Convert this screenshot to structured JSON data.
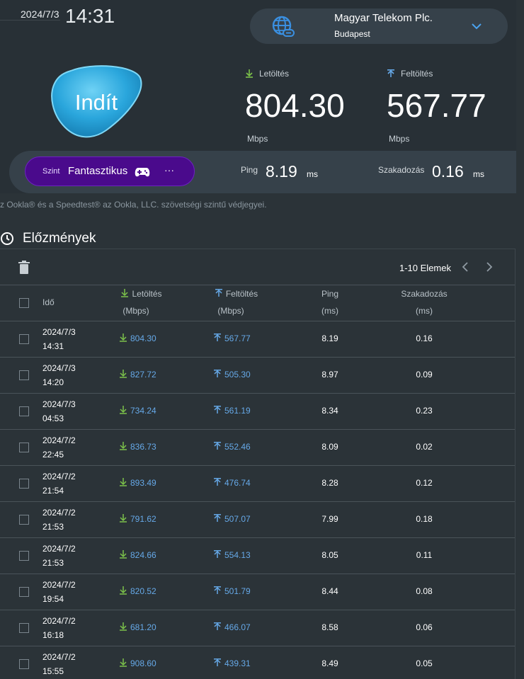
{
  "header": {
    "date": "2024/7/3",
    "time": "14:31"
  },
  "server": {
    "name": "Magyar Telekom Plc.",
    "city": "Budapest"
  },
  "start_button": {
    "label": "Indít"
  },
  "results": {
    "download_label": "Letöltés",
    "download_value": "804.30",
    "download_unit": "Mbps",
    "upload_label": "Feltöltés",
    "upload_value": "567.77",
    "upload_unit": "Mbps",
    "ping_label": "Ping",
    "ping_value": "8.19",
    "ping_unit": "ms",
    "jitter_label": "Szakadozás",
    "jitter_value": "0.16",
    "jitter_unit": "ms"
  },
  "level": {
    "prefix": "Szint",
    "text": "Fantasztikus",
    "more": "···"
  },
  "trademark": "z Ookla® és a Speedtest® az Ookla, LLC. szövetségi szintű védjegyei.",
  "history": {
    "title": "Előzmények",
    "pager": "1-10 Elemek",
    "columns": {
      "time": "Idő",
      "download": "Letöltés",
      "download_unit": "(Mbps)",
      "upload": "Feltöltés",
      "upload_unit": "(Mbps)",
      "ping": "Ping",
      "ping_unit": "(ms)",
      "jitter": "Szakadozás",
      "jitter_unit": "(ms)"
    },
    "rows": [
      {
        "date": "2024/7/3",
        "time": "14:31",
        "download": "804.30",
        "upload": "567.77",
        "ping": "8.19",
        "jitter": "0.16"
      },
      {
        "date": "2024/7/3",
        "time": "14:20",
        "download": "827.72",
        "upload": "505.30",
        "ping": "8.97",
        "jitter": "0.09"
      },
      {
        "date": "2024/7/3",
        "time": "04:53",
        "download": "734.24",
        "upload": "561.19",
        "ping": "8.34",
        "jitter": "0.23"
      },
      {
        "date": "2024/7/2",
        "time": "22:45",
        "download": "836.73",
        "upload": "552.46",
        "ping": "8.09",
        "jitter": "0.02"
      },
      {
        "date": "2024/7/2",
        "time": "21:54",
        "download": "893.49",
        "upload": "476.74",
        "ping": "8.28",
        "jitter": "0.12"
      },
      {
        "date": "2024/7/2",
        "time": "21:53",
        "download": "791.62",
        "upload": "507.07",
        "ping": "7.99",
        "jitter": "0.18"
      },
      {
        "date": "2024/7/2",
        "time": "21:53",
        "download": "824.66",
        "upload": "554.13",
        "ping": "8.05",
        "jitter": "0.11"
      },
      {
        "date": "2024/7/2",
        "time": "19:54",
        "download": "820.52",
        "upload": "501.79",
        "ping": "8.44",
        "jitter": "0.08"
      },
      {
        "date": "2024/7/2",
        "time": "16:18",
        "download": "681.20",
        "upload": "466.07",
        "ping": "8.58",
        "jitter": "0.06"
      },
      {
        "date": "2024/7/2",
        "time": "15:55",
        "download": "908.60",
        "upload": "439.31",
        "ping": "8.49",
        "jitter": "0.05"
      }
    ]
  },
  "colors": {
    "accent_blue": "#66a9e8",
    "download_arrow": "#7cc24a",
    "upload_arrow": "#66a9e8",
    "level_pill": "#4a0a8c"
  },
  "icons": [
    "globe-icon",
    "chevron-down-icon",
    "download-arrow-icon",
    "upload-arrow-icon",
    "gamepad-icon",
    "history-icon",
    "trash-icon",
    "chevron-left-icon",
    "chevron-right-icon",
    "checkbox"
  ]
}
